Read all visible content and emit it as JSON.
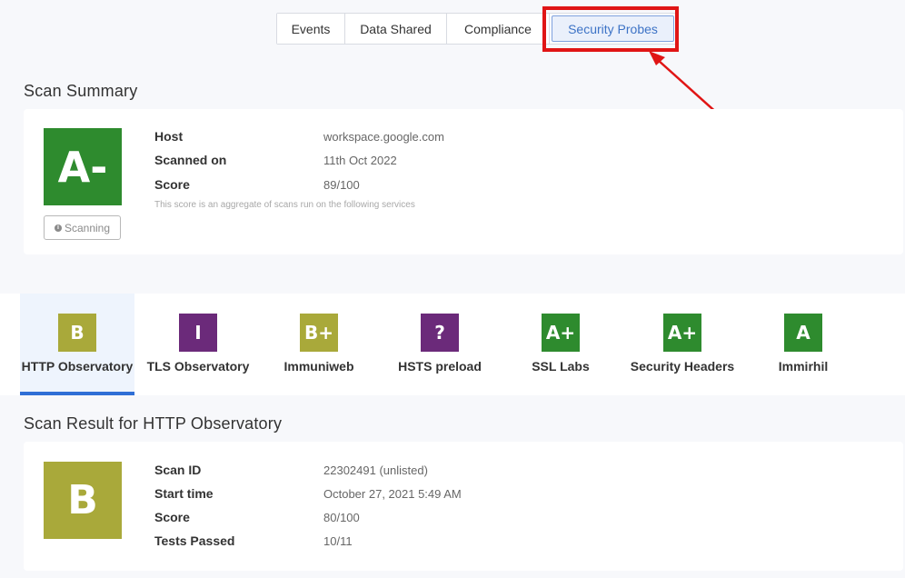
{
  "tabs": [
    {
      "label": "Events",
      "active": false
    },
    {
      "label": "Data Shared",
      "active": false
    },
    {
      "label": "Compliance",
      "active": false
    },
    {
      "label": "Security Probes",
      "active": true
    }
  ],
  "scan_summary": {
    "title": "Scan Summary",
    "grade": "A-",
    "grade_color": "#2e8b2e",
    "scanning_label": "Scanning",
    "host_label": "Host",
    "host_value": "workspace.google.com",
    "scanned_on_label": "Scanned on",
    "scanned_on_value": "11th Oct 2022",
    "score_label": "Score",
    "score_value": "89/100",
    "note": "This score is an aggregate of scans run on the following services"
  },
  "services": [
    {
      "grade": "B",
      "label": "HTTP Observatory",
      "color": "#a9a93a",
      "active": true
    },
    {
      "grade": "I",
      "label": "TLS Observatory",
      "color": "#6b2a7a",
      "active": false
    },
    {
      "grade": "B+",
      "label": "Immuniweb",
      "color": "#a9a93a",
      "active": false
    },
    {
      "grade": "?",
      "label": "HSTS preload",
      "color": "#6b2a7a",
      "active": false
    },
    {
      "grade": "A+",
      "label": "SSL Labs",
      "color": "#2e8b2e",
      "active": false
    },
    {
      "grade": "A+",
      "label": "Security Headers",
      "color": "#2e8b2e",
      "active": false
    },
    {
      "grade": "A",
      "label": "Immirhil",
      "color": "#2e8b2e",
      "active": false
    }
  ],
  "scan_result": {
    "title": "Scan Result for HTTP Observatory",
    "grade": "B",
    "grade_color": "#a9a93a",
    "scan_id_label": "Scan ID",
    "scan_id_value": "22302491 (unlisted)",
    "start_time_label": "Start time",
    "start_time_value": "October 27, 2021 5:49 AM",
    "score_label": "Score",
    "score_value": "80/100",
    "tests_passed_label": "Tests Passed",
    "tests_passed_value": "10/11"
  },
  "colors": {
    "highlight": "#e01515",
    "active_tab": "#3d73c6",
    "active_underline": "#2f6fd6"
  }
}
